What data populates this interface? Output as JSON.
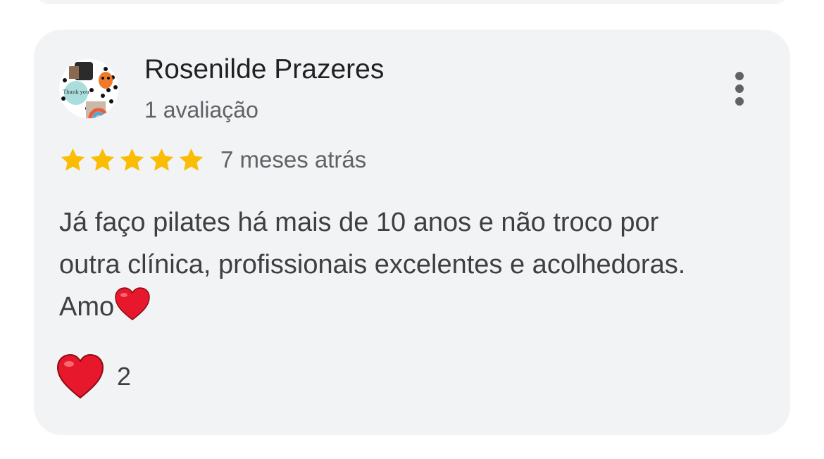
{
  "review": {
    "author": "Rosenilde Prazeres",
    "reviews_count": "1 avaliação",
    "rating": 5,
    "rating_max": 5,
    "time_ago": "7 meses atrás",
    "text_line1": "Já faço pilates há mais de 10 anos e não troco por",
    "text_line2": "outra clínica, profissionais excelentes e acolhedoras.",
    "text_line3": "Amo",
    "reaction_count": "2",
    "avatar_text": "Thank you"
  },
  "colors": {
    "card_bg": "#f2f3f5",
    "star": "#fbbc04",
    "heart": "#e8182c",
    "text_primary": "#202124",
    "text_secondary": "#5f6368"
  },
  "icons": {
    "menu": "more-vert-icon",
    "star": "star-icon",
    "heart": "heart-emoji"
  }
}
